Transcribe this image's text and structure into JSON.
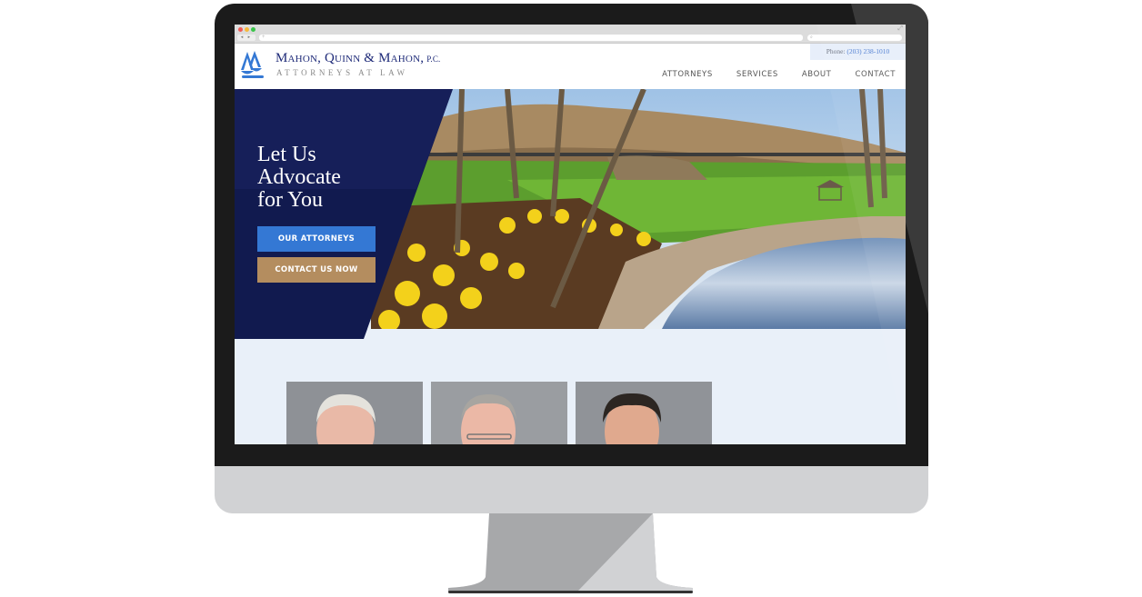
{
  "browser": {
    "nav_buttons": "◂ ▸",
    "address_placeholder": "+",
    "search_icon": "magnifier-icon",
    "search_glyph": "⌕",
    "resize_glyph": "⤢"
  },
  "header": {
    "firm_name": "Mahon, Quinn & Mahon",
    "firm_suffix": "P.C.",
    "tagline": "Attorneys At Law",
    "phone_label": "Phone:",
    "phone_number": "(203) 238-1010",
    "nav": [
      {
        "label": "ATTORNEYS"
      },
      {
        "label": "SERVICES"
      },
      {
        "label": "ABOUT"
      },
      {
        "label": "CONTACT"
      }
    ]
  },
  "hero": {
    "heading_line1": "Let Us",
    "heading_line2": "Advocate",
    "heading_line3": "for You",
    "primary_button": "OUR ATTORNEYS",
    "secondary_button": "CONTACT US NOW"
  },
  "attorneys": [
    {
      "photo": "attorney-portrait-1"
    },
    {
      "photo": "attorney-portrait-2"
    },
    {
      "photo": "attorney-portrait-3"
    }
  ],
  "colors": {
    "brand_navy": "#1e2a78",
    "hero_navy": "#111a4f",
    "button_blue": "#3478d4",
    "button_gold": "#b48d5f",
    "section_bg": "#e9f0f9"
  }
}
